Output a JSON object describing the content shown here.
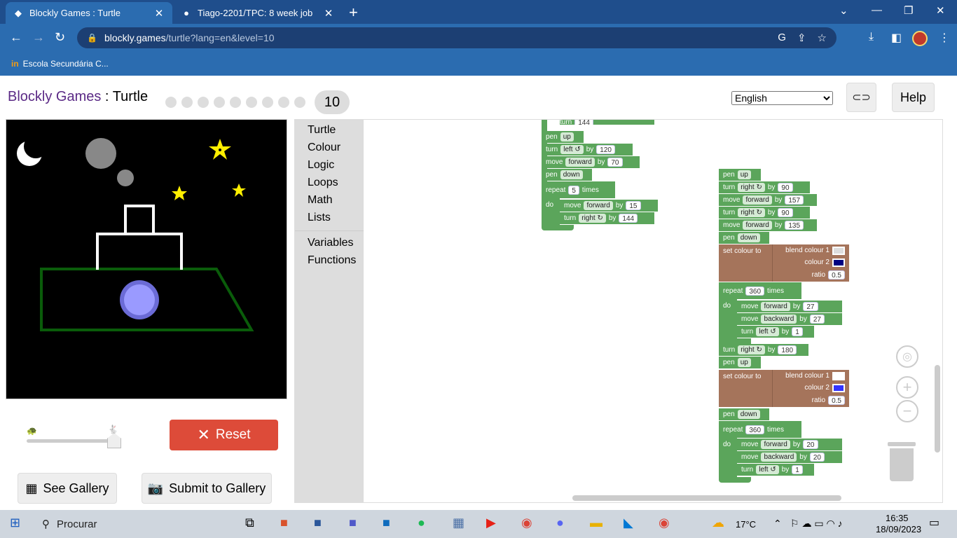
{
  "browser": {
    "tabs": [
      {
        "title": "Blockly Games : Turtle",
        "close": "✕"
      },
      {
        "title": "Tiago-2201/TPC: 8 week job",
        "close": "✕"
      }
    ],
    "new_tab": "+",
    "url_host": "blockly.games",
    "url_path": "/turtle?lang=en&level=10",
    "bookmark": "Escola Secundária C..."
  },
  "header": {
    "brand": "Blockly Games",
    "separator": " : ",
    "app": "Turtle",
    "current_level": "10",
    "language": "English",
    "help_label": "Help"
  },
  "controls": {
    "reset_label": "Reset",
    "see_gallery_label": "See Gallery",
    "submit_gallery_label": "Submit to Gallery",
    "speed": 0.9
  },
  "toolbox": {
    "categories": [
      "Turtle",
      "Colour",
      "Logic",
      "Loops",
      "Math",
      "Lists",
      "Variables",
      "Functions"
    ]
  },
  "blocks": {
    "kw": {
      "pen": "pen",
      "turn": "turn",
      "move": "move",
      "by": "by",
      "repeat": "repeat",
      "times": "times",
      "do": "do",
      "set_colour_to": "set colour to",
      "blend_colour_1": "blend colour 1",
      "colour_2": "colour 2",
      "ratio": "ratio"
    },
    "opt": {
      "up": "up",
      "down": "down",
      "left": "left ↺",
      "right": "right ↻",
      "forward": "forward",
      "backward": "backward"
    },
    "stack1": {
      "top_partial_value": "144",
      "turn_left_value": "120",
      "move_forward_value": "70",
      "repeat_count": "5",
      "inner_move_value": "15",
      "inner_turn_value": "144"
    },
    "stack2": {
      "turn1": "90",
      "move1": "157",
      "turn2": "90",
      "move2": "135",
      "ratio1": "0.5",
      "repeat1": "360",
      "fwd1": "27",
      "back1": "27",
      "left1": "1",
      "turn3": "180",
      "ratio2": "0.5",
      "repeat2": "360",
      "fwd2": "20",
      "back2": "20",
      "left2": "1"
    },
    "colors": {
      "block_green": "#5ba55b",
      "block_brown": "#a5745b",
      "blend1_c1": "#dddddd",
      "blend1_c2": "#000080",
      "blend2_c1": "#ffffff",
      "blend2_c2": "#3333ff"
    }
  },
  "taskbar": {
    "search": "Procurar",
    "weather": "17°C",
    "time": "16:35",
    "date": "18/09/2023"
  }
}
